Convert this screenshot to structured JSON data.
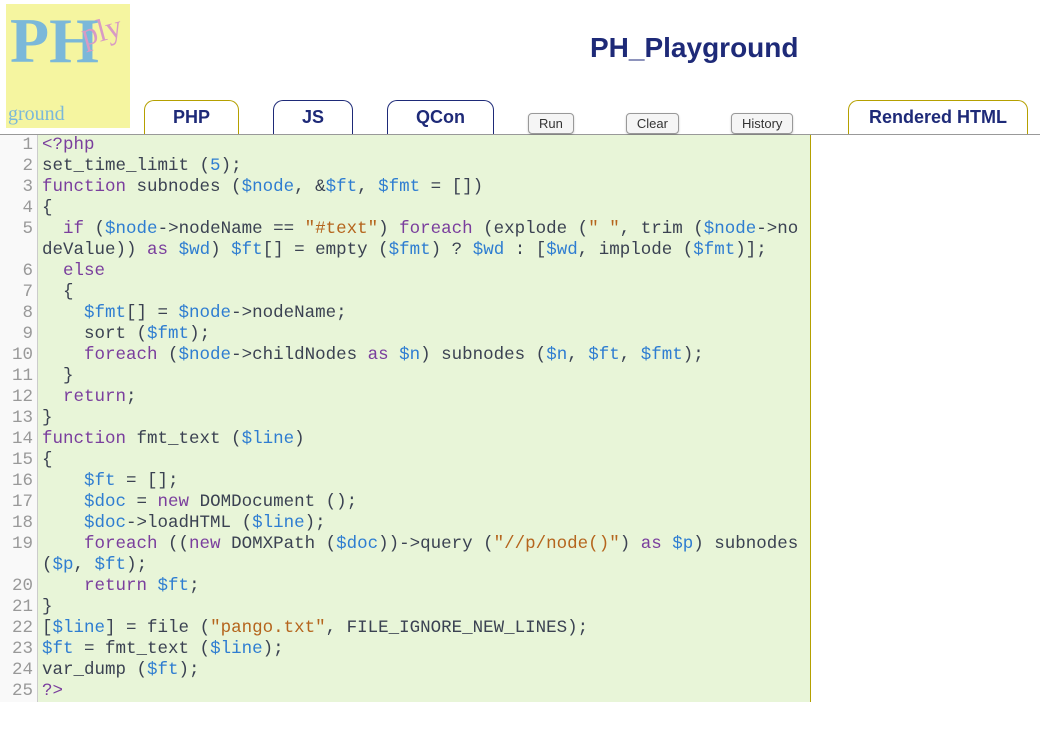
{
  "title": "PH_Playground",
  "logo": {
    "ph": "PH",
    "ply": "ply",
    "ground": "ground"
  },
  "tabs": [
    {
      "label": "PHP",
      "active": true
    },
    {
      "label": "JS",
      "active": false
    },
    {
      "label": "QCon",
      "active": false
    }
  ],
  "actions": [
    {
      "label": "Run"
    },
    {
      "label": "Clear"
    },
    {
      "label": "History"
    }
  ],
  "right_tab": "Rendered HTML",
  "code_lines": [
    [
      {
        "t": "<?php",
        "c": "k"
      }
    ],
    [
      {
        "t": "set_time_limit",
        "c": "f"
      },
      {
        "t": " (",
        "c": "op"
      },
      {
        "t": "5",
        "c": "n"
      },
      {
        "t": ");",
        "c": "op"
      }
    ],
    [
      {
        "t": "function",
        "c": "k"
      },
      {
        "t": " ",
        "c": ""
      },
      {
        "t": "subnodes",
        "c": "f"
      },
      {
        "t": " (",
        "c": "op"
      },
      {
        "t": "$node",
        "c": "v"
      },
      {
        "t": ", &",
        "c": "op"
      },
      {
        "t": "$ft",
        "c": "v"
      },
      {
        "t": ", ",
        "c": "op"
      },
      {
        "t": "$fmt",
        "c": "v"
      },
      {
        "t": " = [])",
        "c": "op"
      }
    ],
    [
      {
        "t": "{",
        "c": "op"
      }
    ],
    [
      {
        "t": "  ",
        "c": ""
      },
      {
        "t": "if",
        "c": "k"
      },
      {
        "t": " (",
        "c": "op"
      },
      {
        "t": "$node",
        "c": "v"
      },
      {
        "t": "->nodeName == ",
        "c": "op"
      },
      {
        "t": "\"#text\"",
        "c": "s"
      },
      {
        "t": ") ",
        "c": "op"
      },
      {
        "t": "foreach",
        "c": "k"
      },
      {
        "t": " (",
        "c": "op"
      },
      {
        "t": "explode",
        "c": "f"
      },
      {
        "t": " (",
        "c": "op"
      },
      {
        "t": "\" \"",
        "c": "s"
      },
      {
        "t": ", ",
        "c": "op"
      },
      {
        "t": "trim",
        "c": "f"
      },
      {
        "t": " (",
        "c": "op"
      },
      {
        "t": "$node",
        "c": "v"
      },
      {
        "t": "->nodeValue)) ",
        "c": "op"
      },
      {
        "t": "as",
        "c": "k"
      },
      {
        "t": " ",
        "c": ""
      },
      {
        "t": "$wd",
        "c": "v"
      },
      {
        "t": ") ",
        "c": "op"
      },
      {
        "t": "$ft",
        "c": "v"
      },
      {
        "t": "[] = ",
        "c": "op"
      },
      {
        "t": "empty",
        "c": "f"
      },
      {
        "t": " (",
        "c": "op"
      },
      {
        "t": "$fmt",
        "c": "v"
      },
      {
        "t": ") ? ",
        "c": "op"
      },
      {
        "t": "$wd",
        "c": "v"
      },
      {
        "t": " : [",
        "c": "op"
      },
      {
        "t": "$wd",
        "c": "v"
      },
      {
        "t": ", ",
        "c": "op"
      },
      {
        "t": "implode",
        "c": "f"
      },
      {
        "t": " (",
        "c": "op"
      },
      {
        "t": "$fmt",
        "c": "v"
      },
      {
        "t": ")];",
        "c": "op"
      }
    ],
    [
      {
        "t": "  ",
        "c": ""
      },
      {
        "t": "else",
        "c": "k"
      }
    ],
    [
      {
        "t": "  {",
        "c": "op"
      }
    ],
    [
      {
        "t": "    ",
        "c": ""
      },
      {
        "t": "$fmt",
        "c": "v"
      },
      {
        "t": "[] = ",
        "c": "op"
      },
      {
        "t": "$node",
        "c": "v"
      },
      {
        "t": "->nodeName;",
        "c": "op"
      }
    ],
    [
      {
        "t": "    ",
        "c": ""
      },
      {
        "t": "sort",
        "c": "f"
      },
      {
        "t": " (",
        "c": "op"
      },
      {
        "t": "$fmt",
        "c": "v"
      },
      {
        "t": ");",
        "c": "op"
      }
    ],
    [
      {
        "t": "    ",
        "c": ""
      },
      {
        "t": "foreach",
        "c": "k"
      },
      {
        "t": " (",
        "c": "op"
      },
      {
        "t": "$node",
        "c": "v"
      },
      {
        "t": "->childNodes ",
        "c": "op"
      },
      {
        "t": "as",
        "c": "k"
      },
      {
        "t": " ",
        "c": ""
      },
      {
        "t": "$n",
        "c": "v"
      },
      {
        "t": ") ",
        "c": "op"
      },
      {
        "t": "subnodes",
        "c": "f"
      },
      {
        "t": " (",
        "c": "op"
      },
      {
        "t": "$n",
        "c": "v"
      },
      {
        "t": ", ",
        "c": "op"
      },
      {
        "t": "$ft",
        "c": "v"
      },
      {
        "t": ", ",
        "c": "op"
      },
      {
        "t": "$fmt",
        "c": "v"
      },
      {
        "t": ");",
        "c": "op"
      }
    ],
    [
      {
        "t": "  }",
        "c": "op"
      }
    ],
    [
      {
        "t": "  ",
        "c": ""
      },
      {
        "t": "return",
        "c": "k"
      },
      {
        "t": ";",
        "c": "op"
      }
    ],
    [
      {
        "t": "}",
        "c": "op"
      }
    ],
    [
      {
        "t": "function",
        "c": "k"
      },
      {
        "t": " ",
        "c": ""
      },
      {
        "t": "fmt_text",
        "c": "f"
      },
      {
        "t": " (",
        "c": "op"
      },
      {
        "t": "$line",
        "c": "v"
      },
      {
        "t": ")",
        "c": "op"
      }
    ],
    [
      {
        "t": "{",
        "c": "op"
      }
    ],
    [
      {
        "t": "    ",
        "c": ""
      },
      {
        "t": "$ft",
        "c": "v"
      },
      {
        "t": " = [];",
        "c": "op"
      }
    ],
    [
      {
        "t": "    ",
        "c": ""
      },
      {
        "t": "$doc",
        "c": "v"
      },
      {
        "t": " = ",
        "c": "op"
      },
      {
        "t": "new",
        "c": "k"
      },
      {
        "t": " ",
        "c": ""
      },
      {
        "t": "DOMDocument",
        "c": "f"
      },
      {
        "t": " ();",
        "c": "op"
      }
    ],
    [
      {
        "t": "    ",
        "c": ""
      },
      {
        "t": "$doc",
        "c": "v"
      },
      {
        "t": "->",
        "c": "op"
      },
      {
        "t": "loadHTML",
        "c": "f"
      },
      {
        "t": " (",
        "c": "op"
      },
      {
        "t": "$line",
        "c": "v"
      },
      {
        "t": ");",
        "c": "op"
      }
    ],
    [
      {
        "t": "    ",
        "c": ""
      },
      {
        "t": "foreach",
        "c": "k"
      },
      {
        "t": " ((",
        "c": "op"
      },
      {
        "t": "new",
        "c": "k"
      },
      {
        "t": " ",
        "c": ""
      },
      {
        "t": "DOMXPath",
        "c": "f"
      },
      {
        "t": " (",
        "c": "op"
      },
      {
        "t": "$doc",
        "c": "v"
      },
      {
        "t": "))->",
        "c": "op"
      },
      {
        "t": "query",
        "c": "f"
      },
      {
        "t": " (",
        "c": "op"
      },
      {
        "t": "\"//p/node()\"",
        "c": "s"
      },
      {
        "t": ") ",
        "c": "op"
      },
      {
        "t": "as",
        "c": "k"
      },
      {
        "t": " ",
        "c": ""
      },
      {
        "t": "$p",
        "c": "v"
      },
      {
        "t": ") ",
        "c": "op"
      },
      {
        "t": "subnodes",
        "c": "f"
      },
      {
        "t": " (",
        "c": "op"
      },
      {
        "t": "$p",
        "c": "v"
      },
      {
        "t": ", ",
        "c": "op"
      },
      {
        "t": "$ft",
        "c": "v"
      },
      {
        "t": ");",
        "c": "op"
      }
    ],
    [
      {
        "t": "    ",
        "c": ""
      },
      {
        "t": "return",
        "c": "k"
      },
      {
        "t": " ",
        "c": ""
      },
      {
        "t": "$ft",
        "c": "v"
      },
      {
        "t": ";",
        "c": "op"
      }
    ],
    [
      {
        "t": "}",
        "c": "op"
      }
    ],
    [
      {
        "t": "[",
        "c": "op"
      },
      {
        "t": "$line",
        "c": "v"
      },
      {
        "t": "] = ",
        "c": "op"
      },
      {
        "t": "file",
        "c": "f"
      },
      {
        "t": " (",
        "c": "op"
      },
      {
        "t": "\"pango.txt\"",
        "c": "s"
      },
      {
        "t": ", FILE_IGNORE_NEW_LINES);",
        "c": "op"
      }
    ],
    [
      {
        "t": "$ft",
        "c": "v"
      },
      {
        "t": " = ",
        "c": "op"
      },
      {
        "t": "fmt_text",
        "c": "f"
      },
      {
        "t": " (",
        "c": "op"
      },
      {
        "t": "$line",
        "c": "v"
      },
      {
        "t": ");",
        "c": "op"
      }
    ],
    [
      {
        "t": "var_dump",
        "c": "f"
      },
      {
        "t": " (",
        "c": "op"
      },
      {
        "t": "$ft",
        "c": "v"
      },
      {
        "t": ");",
        "c": "op"
      }
    ],
    [
      {
        "t": "?>",
        "c": "k"
      }
    ]
  ],
  "line_count": 25
}
